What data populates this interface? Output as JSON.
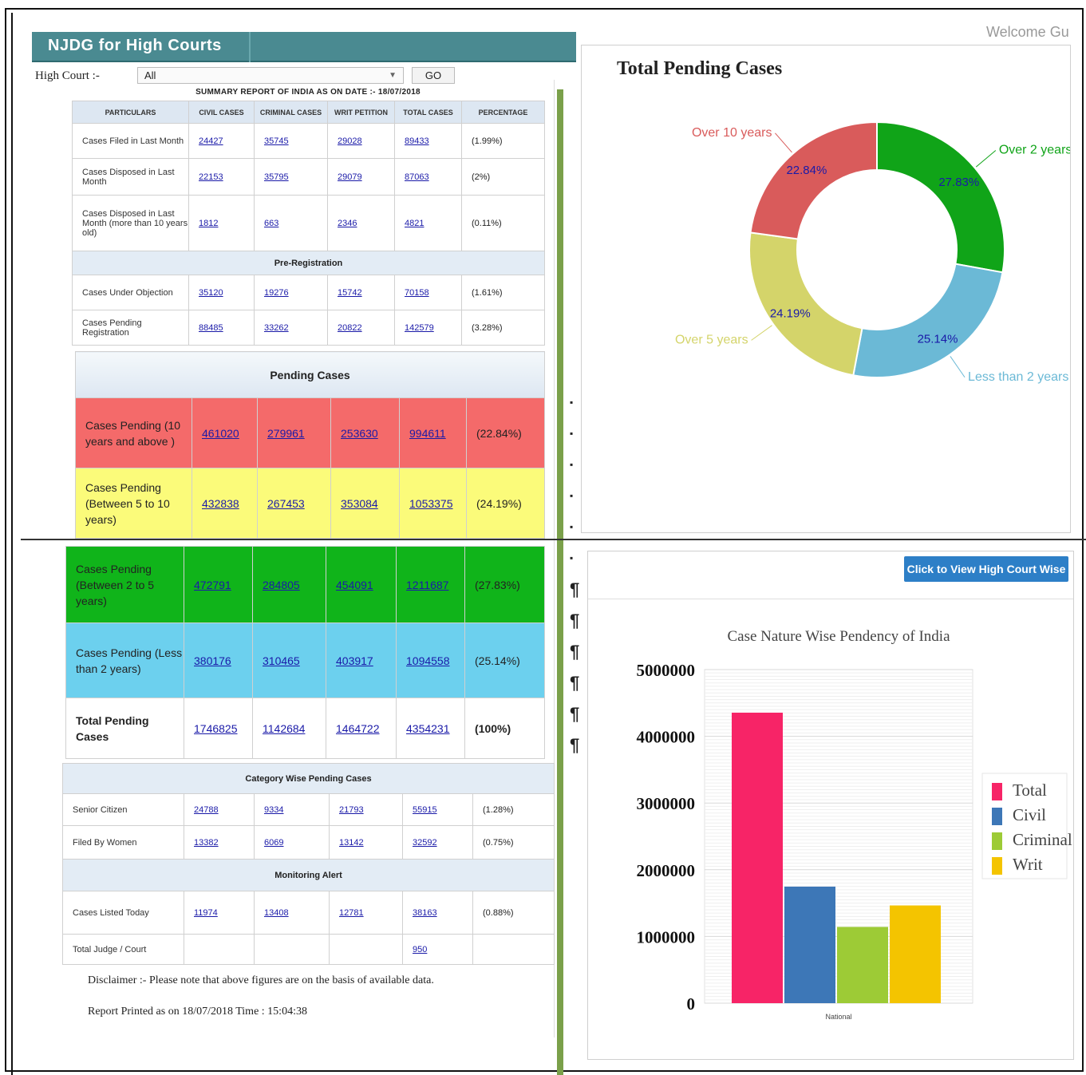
{
  "header": {
    "brand": "NJDG for High Courts"
  },
  "filter": {
    "label": "High Court :-",
    "selected": "All",
    "go_label": "GO"
  },
  "report": {
    "title": "SUMMARY REPORT OF INDIA AS ON DATE :- 18/07/2018",
    "columns": [
      "PARTICULARS",
      "CIVIL CASES",
      "CRIMINAL CASES",
      "WRIT PETITION",
      "TOTAL CASES",
      "PERCENTAGE"
    ],
    "rows_top": [
      {
        "label": "Cases Filed in Last Month",
        "civil": "24427",
        "criminal": "35745",
        "writ": "29028",
        "total": "89433",
        "pct": "(1.99%)"
      },
      {
        "label": "Cases Disposed in Last Month",
        "civil": "22153",
        "criminal": "35795",
        "writ": "29079",
        "total": "87063",
        "pct": "(2%)"
      },
      {
        "label": "Cases Disposed in Last Month (more than 10 years old)",
        "civil": "1812",
        "criminal": "663",
        "writ": "2346",
        "total": "4821",
        "pct": "(0.11%)"
      }
    ],
    "prereg_title": "Pre-Registration",
    "rows_prereg": [
      {
        "label": "Cases Under Objection",
        "civil": "35120",
        "criminal": "19276",
        "writ": "15742",
        "total": "70158",
        "pct": "(1.61%)"
      },
      {
        "label": "Cases Pending Registration",
        "civil": "88485",
        "criminal": "33262",
        "writ": "20822",
        "total": "142579",
        "pct": "(3.28%)"
      }
    ],
    "pending_title": "Pending Cases",
    "rows_pending": [
      {
        "label": "Cases Pending (10 years and above )",
        "civil": "461020",
        "criminal": "279961",
        "writ": "253630",
        "total": "994611",
        "pct": "(22.84%)"
      },
      {
        "label": "Cases Pending (Between 5 to 10 years)",
        "civil": "432838",
        "criminal": "267453",
        "writ": "353084",
        "total": "1053375",
        "pct": "(24.19%)"
      },
      {
        "label": "Cases Pending (Between 2 to 5 years)",
        "civil": "472791",
        "criminal": "284805",
        "writ": "454091",
        "total": "1211687",
        "pct": "(27.83%)"
      },
      {
        "label": "Cases Pending (Less than 2 years)",
        "civil": "380176",
        "criminal": "310465",
        "writ": "403917",
        "total": "1094558",
        "pct": "(25.14%)"
      }
    ],
    "total_row": {
      "label": "Total Pending Cases",
      "civil": "1746825",
      "criminal": "1142684",
      "writ": "1464722",
      "total": "4354231",
      "pct": "(100%)"
    },
    "category_title": "Category Wise Pending Cases",
    "rows_category": [
      {
        "label": "Senior Citizen",
        "civil": "24788",
        "criminal": "9334",
        "writ": "21793",
        "total": "55915",
        "pct": "(1.28%)"
      },
      {
        "label": "Filed By Women",
        "civil": "13382",
        "criminal": "6069",
        "writ": "13142",
        "total": "32592",
        "pct": "(0.75%)"
      }
    ],
    "monitoring_title": "Monitoring Alert",
    "rows_monitoring": [
      {
        "label": "Cases Listed Today",
        "civil": "11974",
        "criminal": "13408",
        "writ": "12781",
        "total": "38163",
        "pct": "(0.88%)"
      },
      {
        "label": "Total Judge / Court",
        "civil": "",
        "criminal": "",
        "writ": "",
        "total": "950",
        "pct": ""
      }
    ],
    "disclaimer": "Disclaimer :- Please note that above figures are on the basis of available data.",
    "printed": "Report Printed as on 18/07/2018 Time : 15:04:38"
  },
  "welcome": "Welcome Gu",
  "view_button": "Click to View High Court Wise",
  "colors": {
    "header": "#4a8a91",
    "red": "#f46a6a",
    "yellow": "#fbfb7a",
    "green": "#10b41a",
    "blue": "#6cd0ee",
    "link": "#1a1aa8"
  },
  "chart_data": [
    {
      "type": "pie",
      "title": "Total Pending Cases",
      "donut": true,
      "slices": [
        {
          "label": "Over 2 years",
          "value": 27.83,
          "value_label": "27.83%",
          "color": "#10a418"
        },
        {
          "label": "Less than 2 years",
          "value": 25.14,
          "value_label": "25.14%",
          "color": "#6bb9d6"
        },
        {
          "label": "Over 5 years",
          "value": 24.19,
          "value_label": "24.19%",
          "color": "#d4d46a"
        },
        {
          "label": "Over 10 years",
          "value": 22.84,
          "value_label": "22.84%",
          "color": "#d95b5b"
        }
      ]
    },
    {
      "type": "bar",
      "title": "Case Nature Wise Pendency of India",
      "categories": [
        "National"
      ],
      "series": [
        {
          "name": "Total",
          "values": [
            4354231
          ],
          "color": "#f72467"
        },
        {
          "name": "Civil",
          "values": [
            1746825
          ],
          "color": "#3d77b7"
        },
        {
          "name": "Criminal",
          "values": [
            1142684
          ],
          "color": "#9dcb36"
        },
        {
          "name": "Writ",
          "values": [
            1464722
          ],
          "color": "#f4c400"
        }
      ],
      "ylim": [
        0,
        5000000
      ],
      "yticks": [
        "0",
        "1000000",
        "2000000",
        "3000000",
        "4000000",
        "5000000"
      ],
      "grid": true,
      "legend": "right"
    }
  ]
}
